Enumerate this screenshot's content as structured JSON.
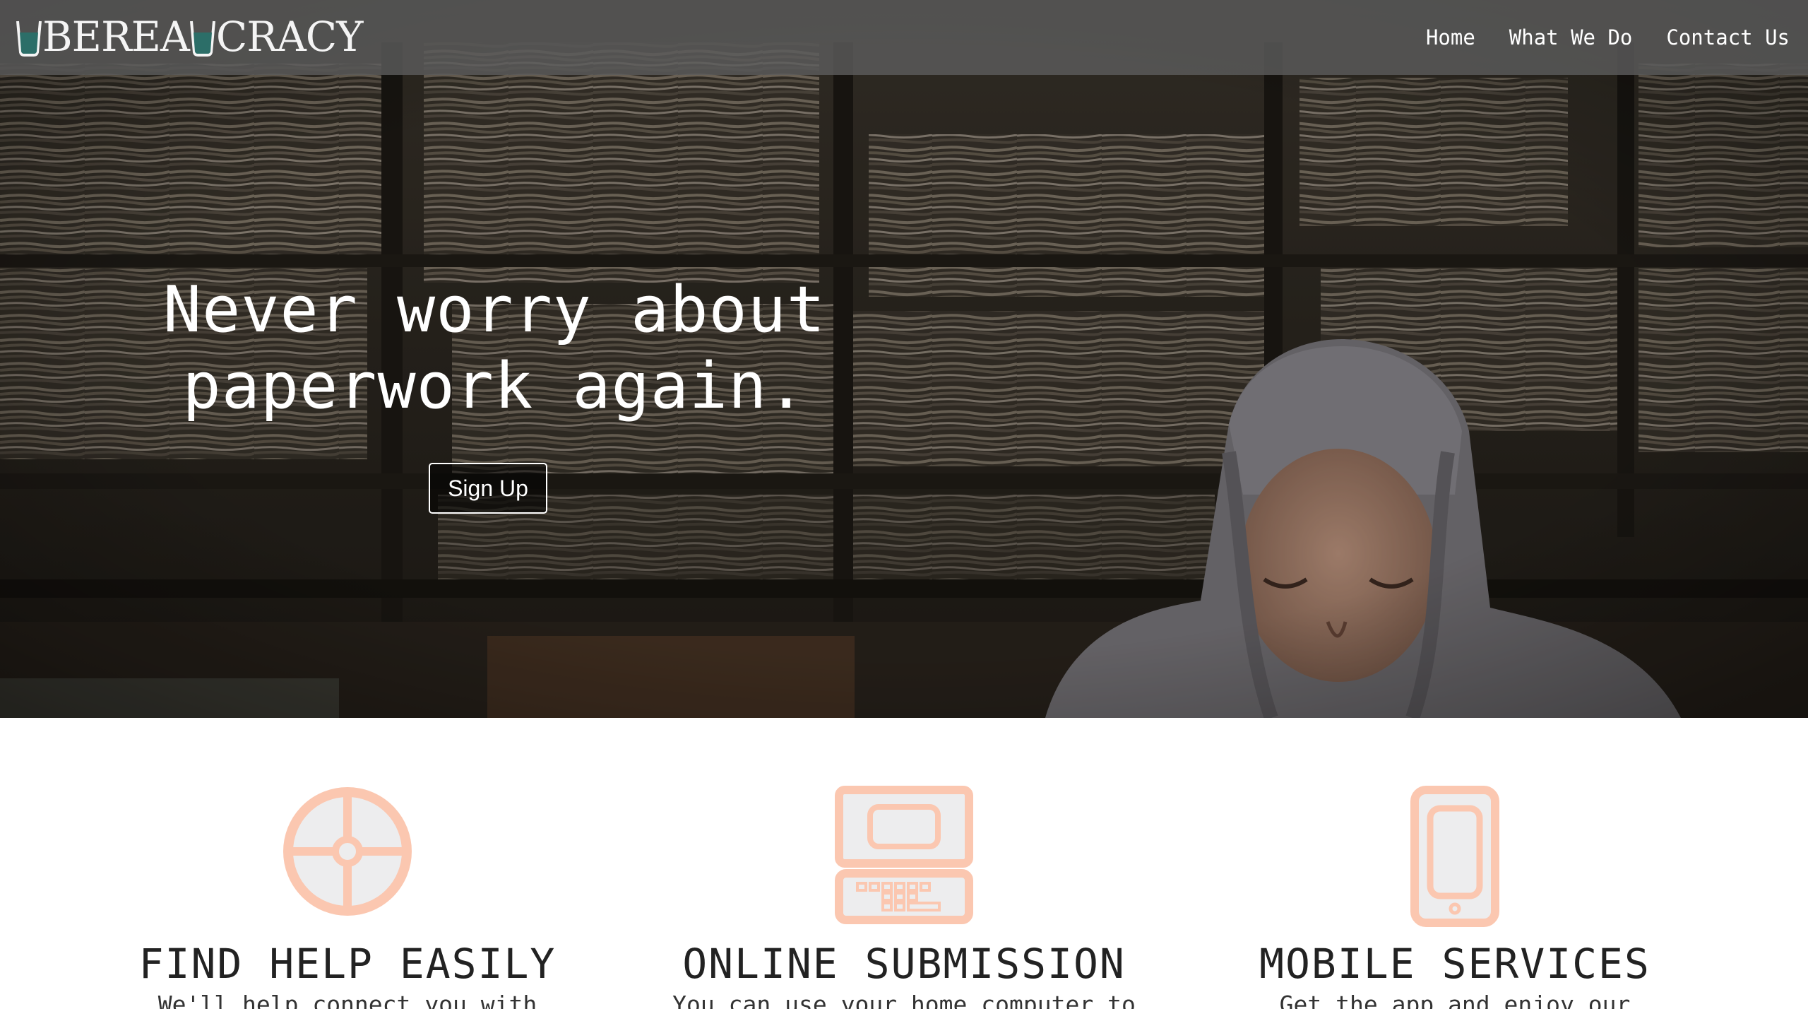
{
  "brand": {
    "name": "UBEREAUCRACY",
    "mid_text": "BEREA",
    "end_text": "CRACY"
  },
  "nav": {
    "items": [
      {
        "label": "Home"
      },
      {
        "label": "What We Do"
      },
      {
        "label": "Contact Us"
      }
    ]
  },
  "hero": {
    "title_line1": "Never worry about",
    "title_line2": "paperwork again.",
    "cta_label": "Sign Up"
  },
  "features": [
    {
      "icon": "crosshair-icon",
      "title": "FIND HELP EASILY",
      "text": "We'll help connect you with"
    },
    {
      "icon": "computer-icon",
      "title": "ONLINE SUBMISSION",
      "text": "You can use your home computer to"
    },
    {
      "icon": "mobile-icon",
      "title": "MOBILE SERVICES",
      "text": "Get the app and enjoy our"
    }
  ],
  "colors": {
    "navbar_bg": "#5c5c5c",
    "accent_teal": "#2c6e68",
    "icon_peach": "#fbc7b0",
    "icon_fill": "#ededee",
    "text_dark": "#222222"
  }
}
